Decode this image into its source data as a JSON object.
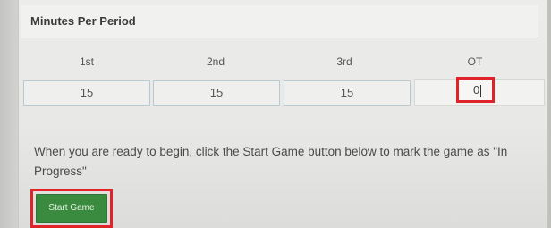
{
  "section": {
    "title": "Minutes Per Period"
  },
  "periods": [
    {
      "label": "1st",
      "value": "15"
    },
    {
      "label": "2nd",
      "value": "15"
    },
    {
      "label": "3rd",
      "value": "15"
    },
    {
      "label": "OT",
      "value": "0"
    }
  ],
  "instructions": {
    "text": "When you are ready to begin, click the Start Game button below to mark the game as \"In Progress\""
  },
  "actions": {
    "start_game_label": "Start Game"
  },
  "colors": {
    "highlight": "#e0232b",
    "start_button": "#3a8b3f"
  }
}
